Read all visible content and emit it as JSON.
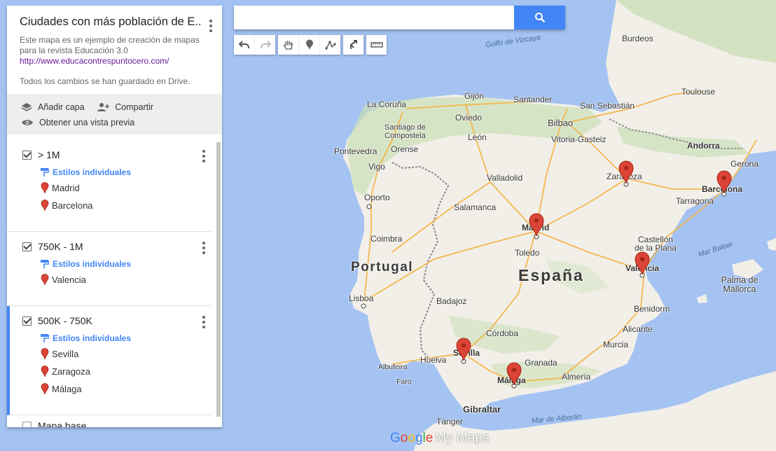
{
  "panel": {
    "title": "Ciudades con más población de E...",
    "description": "Este mapa es un ejemplo de creación de mapas para la revista Educación 3.0",
    "link": "http://www.educacontrespuntocero.com/",
    "save_status": "Todos los cambios se han guardado en Drive.",
    "actions": {
      "add_layer": "Añadir capa",
      "share": "Compartir",
      "preview": "Obtener una vista previa"
    },
    "style_link": "Estilos individuales",
    "layers": [
      {
        "name": "> 1M",
        "items": [
          "Madrid",
          "Barcelona"
        ]
      },
      {
        "name": "750K - 1M",
        "items": [
          "Valencia"
        ]
      },
      {
        "name": "500K - 750K",
        "items": [
          "Sevilla",
          "Zaragoza",
          "Málaga"
        ]
      }
    ],
    "base_map": "Mapa base"
  },
  "search": {
    "placeholder": "",
    "value": ""
  },
  "logo": {
    "google": "Google",
    "my_maps": "My Maps"
  },
  "colors": {
    "accent": "#4285f4",
    "pin": "#db4437",
    "sea": "#a4c3f2",
    "land": "#f2efe9",
    "green": "#cbdfb7"
  },
  "map": {
    "countries": [
      "España",
      "Portugal"
    ],
    "regions": [
      "Andorra",
      "Gibraltar"
    ],
    "seas": [
      "Golfo de Vizcaya",
      "Mar Balear",
      "Mar de Alborán"
    ],
    "cities": [
      "Madrid",
      "Barcelona",
      "Valencia",
      "Sevilla",
      "Zaragoza",
      "Málaga",
      "Lisboa",
      "Oporto",
      "Burdeos",
      "Toulouse",
      "Andorra",
      "Gerona",
      "Tarragona",
      "Bilbao",
      "San Sebastián",
      "Santander",
      "Gijón",
      "Oviedo",
      "La Coruña",
      "Santiago de Compostela",
      "Orense",
      "Pontevedra",
      "Vigo",
      "León",
      "Vitoria-Gasteiz",
      "Valladolid",
      "Salamanca",
      "Coimbra",
      "Toledo",
      "Castellón de la Plana",
      "Palma de Mallorca",
      "Badajoz",
      "Córdoba",
      "Benidorm",
      "Alicante",
      "Murcia",
      "Huelva",
      "Granada",
      "Almería",
      "Albufeira",
      "Faro",
      "Tánger"
    ],
    "pins": [
      "Madrid",
      "Barcelona",
      "Valencia",
      "Sevilla",
      "Zaragoza",
      "Málaga"
    ]
  }
}
